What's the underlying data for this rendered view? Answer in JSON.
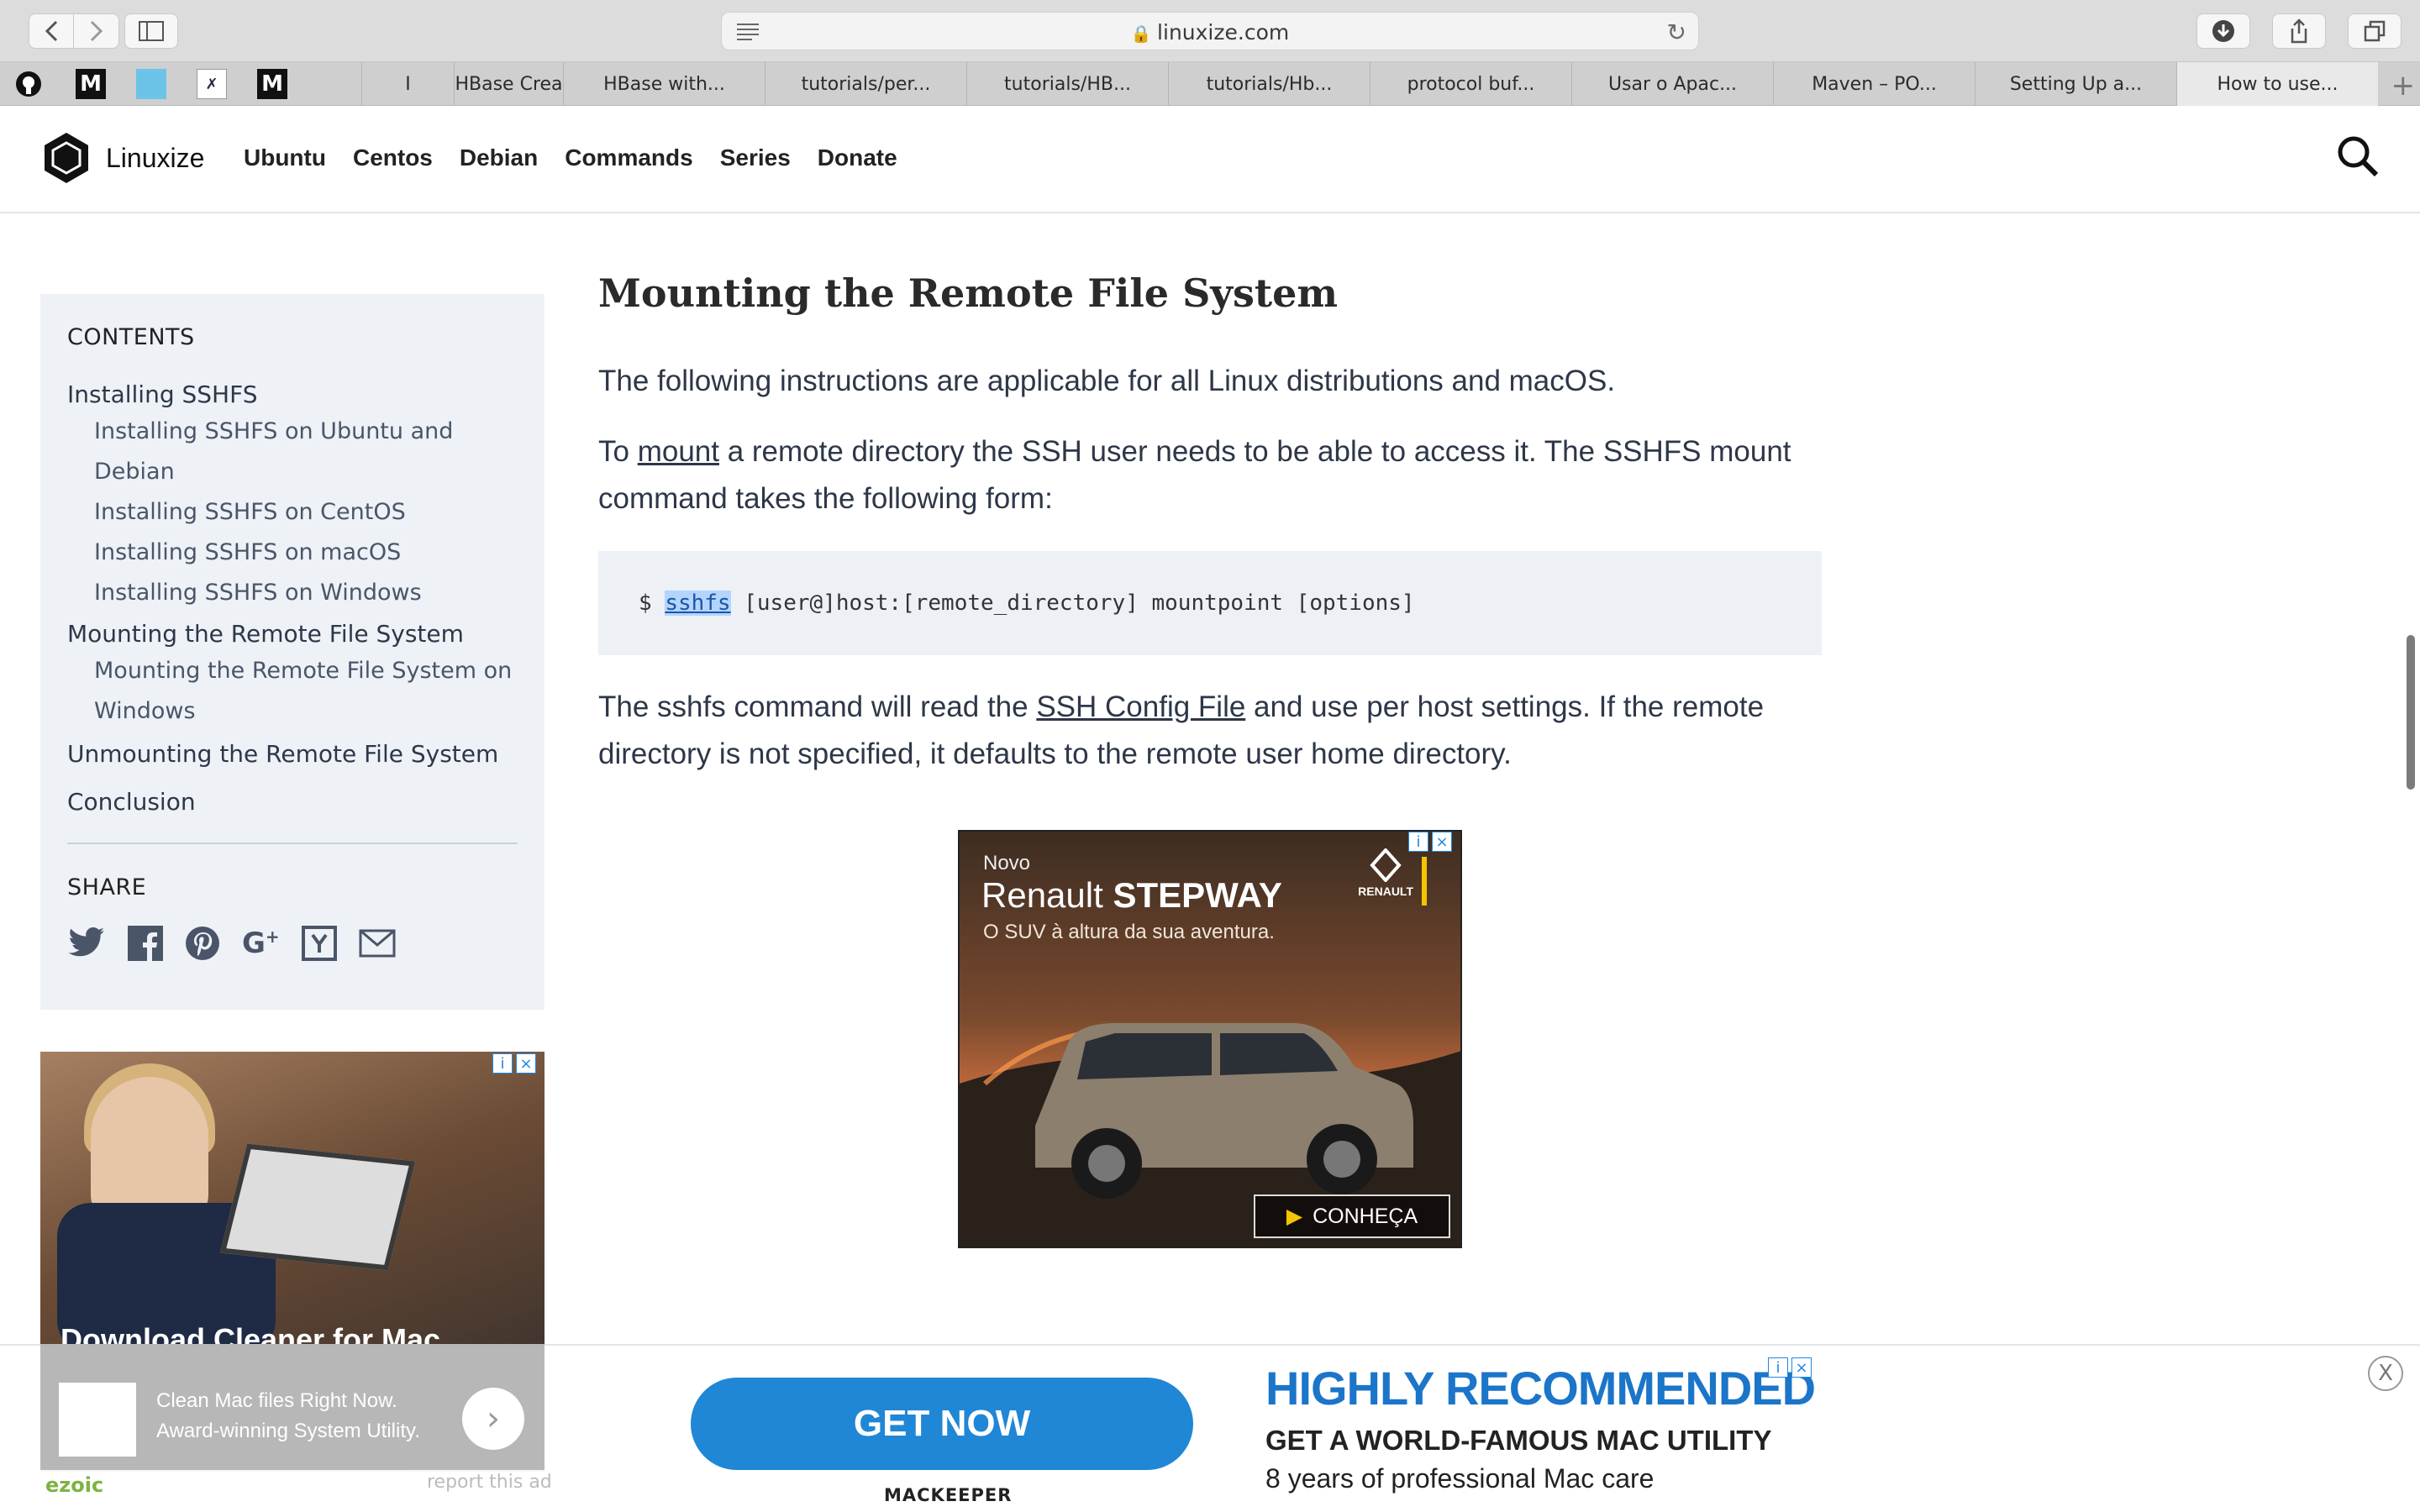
{
  "browser": {
    "url": "linuxize.com",
    "favicons": [
      "github-icon",
      "medium-icon",
      "tab-app-icon",
      "link-icon",
      "medium-icon"
    ],
    "favicon_labels": [
      "M",
      "M"
    ],
    "tabs": [
      {
        "label": "I",
        "active": false
      },
      {
        "label": "HBase Crea",
        "active": false
      },
      {
        "label": "HBase with...",
        "active": false
      },
      {
        "label": "tutorials/per...",
        "active": false
      },
      {
        "label": "tutorials/HB...",
        "active": false
      },
      {
        "label": "tutorials/Hb...",
        "active": false
      },
      {
        "label": "protocol buf...",
        "active": false
      },
      {
        "label": "Usar o Apac...",
        "active": false
      },
      {
        "label": "Maven – PO...",
        "active": false
      },
      {
        "label": "Setting Up a...",
        "active": false
      },
      {
        "label": "How to use...",
        "active": true
      }
    ],
    "new_tab": "+"
  },
  "site": {
    "logo_text": "Linuxize",
    "nav": [
      "Ubuntu",
      "Centos",
      "Debian",
      "Commands",
      "Series",
      "Donate"
    ]
  },
  "toc": {
    "heading": "CONTENTS",
    "items": [
      {
        "label": "Installing SSHFS",
        "level": 1
      },
      {
        "label": "Installing SSHFS on Ubuntu and Debian",
        "level": 2
      },
      {
        "label": "Installing SSHFS on CentOS",
        "level": 2
      },
      {
        "label": "Installing SSHFS on macOS",
        "level": 2
      },
      {
        "label": "Installing SSHFS on Windows",
        "level": 2
      },
      {
        "label": "Mounting the Remote File System",
        "level": 1
      },
      {
        "label": "Mounting the Remote File System on",
        "level": 2
      },
      {
        "label": "Windows",
        "level": 2
      },
      {
        "label": "Unmounting the Remote File System",
        "level": 1
      },
      {
        "label": "Conclusion",
        "level": 1
      }
    ],
    "share_heading": "SHARE",
    "share_icons": [
      "twitter-icon",
      "facebook-icon",
      "pinterest-icon",
      "google-plus-icon",
      "hacker-news-icon",
      "email-icon"
    ]
  },
  "article": {
    "heading": "Mounting the Remote File System",
    "p1": "The following instructions are applicable for all Linux distributions and macOS.",
    "p2_before": "To ",
    "p2_link": "mount",
    "p2_after": " a remote directory the SSH user needs to be able to access it. The SSHFS mount command takes the following form:",
    "code_prompt": "$ ",
    "code_cmd": "sshfs",
    "code_rest": " [user@]host:[remote_directory] mountpoint [options]",
    "p3_before": "The sshfs command will read the ",
    "p3_link": "SSH Config File",
    "p3_after": " and use per host settings. If the remote directory is not specified, it defaults to the remote user home directory."
  },
  "ad_car": {
    "novo": "Novo",
    "brand_light": "Renault ",
    "brand_bold": "STEPWAY",
    "tagline": "O SUV à altura da sua aventura.",
    "logo_label": "RENAULT",
    "cta": "CONHEÇA"
  },
  "ad_side": {
    "title": "Download Cleaner for Mac",
    "line1": "Clean Mac files Right Now.",
    "line2": "Award-winning System Utility.",
    "ezoic": "ezoic",
    "report": "report this ad"
  },
  "ad_bottom": {
    "cta": "GET NOW",
    "brand": "MACKEEPER",
    "headline": "HIGHLY RECOMMENDED",
    "sub1": "GET A WORLD-FAMOUS MAC UTILITY",
    "sub2": "8 years of professional Mac care",
    "close": "X"
  },
  "ad_controls": {
    "info": "i",
    "close": "×"
  }
}
